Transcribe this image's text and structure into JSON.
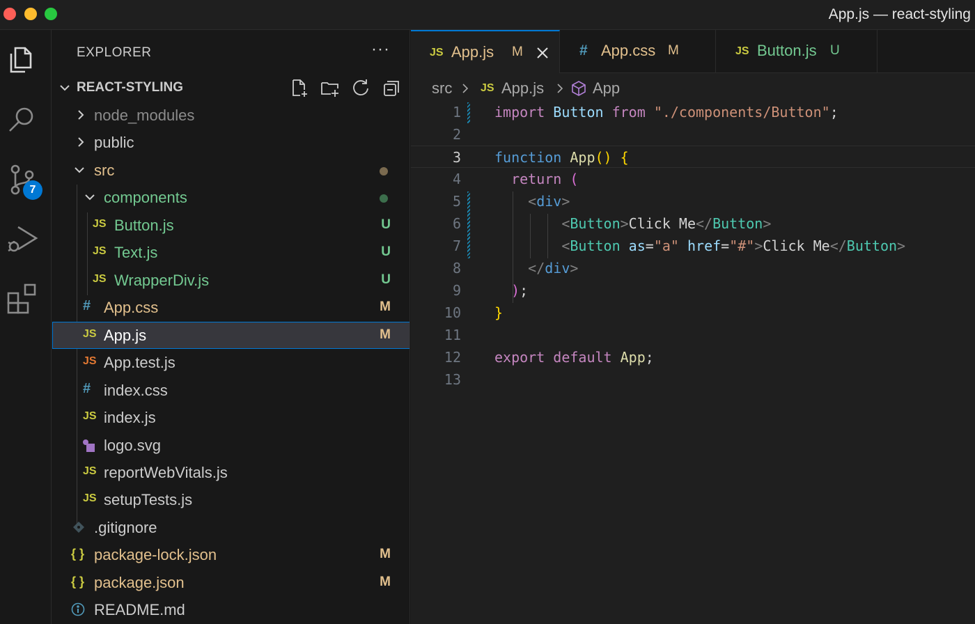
{
  "window": {
    "title": "App.js — react-styling"
  },
  "activity_bar": {
    "items": [
      {
        "icon": "files-icon"
      },
      {
        "icon": "search-icon"
      },
      {
        "icon": "source-control-icon",
        "badge": "7"
      },
      {
        "icon": "run-debug-icon"
      },
      {
        "icon": "extensions-icon"
      }
    ]
  },
  "explorer": {
    "header": "EXPLORER",
    "more": "···",
    "section_title": "REACT-STYLING",
    "tree": [
      {
        "label": "node_modules",
        "type": "folder",
        "open": false,
        "color": "#8c8c8c"
      },
      {
        "label": "public",
        "type": "folder",
        "open": false,
        "color": "#cccccc"
      },
      {
        "label": "src",
        "type": "folder",
        "open": true,
        "color": "#e2c08d",
        "dot": "#7a6a4f"
      },
      {
        "label": "components",
        "type": "folder",
        "open": true,
        "color": "#73c991",
        "dot": "#3c6e4c"
      },
      {
        "label": "Button.js",
        "type": "js",
        "icon": "JS",
        "color": "#73c991",
        "status": "U"
      },
      {
        "label": "Text.js",
        "type": "js",
        "icon": "JS",
        "color": "#73c991",
        "status": "U"
      },
      {
        "label": "WrapperDiv.js",
        "type": "js",
        "icon": "JS",
        "color": "#73c991",
        "status": "U"
      },
      {
        "label": "App.css",
        "type": "css",
        "icon": "#",
        "color": "#e2c08d",
        "status": "M"
      },
      {
        "label": "App.js",
        "type": "js",
        "icon": "JS",
        "color": "#ffffff",
        "status": "M",
        "selected": true
      },
      {
        "label": "App.test.js",
        "type": "test",
        "icon": "JS",
        "color": "#cccccc"
      },
      {
        "label": "index.css",
        "type": "css",
        "icon": "#",
        "color": "#cccccc"
      },
      {
        "label": "index.js",
        "type": "js",
        "icon": "JS",
        "color": "#cccccc"
      },
      {
        "label": "logo.svg",
        "type": "svg",
        "icon": "svg",
        "color": "#cccccc"
      },
      {
        "label": "reportWebVitals.js",
        "type": "js",
        "icon": "JS",
        "color": "#cccccc"
      },
      {
        "label": "setupTests.js",
        "type": "js",
        "icon": "JS",
        "color": "#cccccc"
      },
      {
        "label": ".gitignore",
        "type": "git",
        "icon": "git",
        "color": "#cccccc"
      },
      {
        "label": "package-lock.json",
        "type": "json",
        "icon": "{ }",
        "color": "#e2c08d",
        "status": "M"
      },
      {
        "label": "package.json",
        "type": "json",
        "icon": "{ }",
        "color": "#e2c08d",
        "status": "M"
      },
      {
        "label": "README.md",
        "type": "info",
        "icon": "i",
        "color": "#cccccc"
      }
    ]
  },
  "tabs": [
    {
      "icon": "JS",
      "label": "App.js",
      "status": "M",
      "active": true,
      "color": "#e2c08d"
    },
    {
      "icon": "#",
      "label": "App.css",
      "status": "M",
      "active": false,
      "color": "#e2c08d"
    },
    {
      "icon": "JS",
      "label": "Button.js",
      "status": "U",
      "active": false,
      "color": "#73c991"
    }
  ],
  "breadcrumb": {
    "folder": "src",
    "file": "App.js",
    "symbol": "App"
  },
  "editor": {
    "current_line": 3,
    "line_numbers": [
      "1",
      "2",
      "3",
      "4",
      "5",
      "6",
      "7",
      "8",
      "9",
      "10",
      "11",
      "12",
      "13"
    ],
    "code": {
      "l1": {
        "import": "import",
        "name": "Button",
        "from": "from",
        "path": "\"./components/Button\"",
        "semi": ";"
      },
      "l3": {
        "function": "function",
        "name": "App",
        "parens": "()",
        "brace": "{"
      },
      "l4": {
        "return": "return",
        "paren": "("
      },
      "l5": {
        "open": "<",
        "tag": "div",
        "close": ">"
      },
      "l6": {
        "open": "<",
        "tag": "Button",
        "close": ">",
        "text": "Click Me",
        "end_open": "</",
        "end_tag": "Button",
        "end_close": ">"
      },
      "l7": {
        "open": "<",
        "tag": "Button",
        "attr1": "as",
        "eq1": "=",
        "val1": "\"a\"",
        "attr2": "href",
        "eq2": "=",
        "val2": "\"#\"",
        "close": ">",
        "text": "Click Me",
        "end_open": "</",
        "end_tag": "Button",
        "end_close": ">"
      },
      "l8": {
        "open": "</",
        "tag": "div",
        "close": ">"
      },
      "l9": {
        "paren": ")",
        "semi": ";"
      },
      "l10": {
        "brace": "}"
      },
      "l12": {
        "export": "export",
        "default": "default",
        "name": "App",
        "semi": ";"
      }
    }
  }
}
